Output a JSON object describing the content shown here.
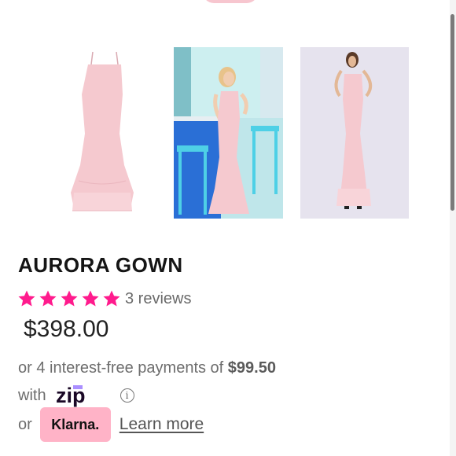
{
  "product": {
    "title": "AURORA GOWN",
    "rating_stars": 5,
    "reviews_text": "3 reviews",
    "price": "$398.00"
  },
  "payments": {
    "installments_prefix": "or 4 interest-free payments of ",
    "installment_amount": "$99.50",
    "with_label": "with",
    "zip_logo_text": "zip",
    "or_label": "or",
    "klarna_label": "Klarna.",
    "learn_more_label": "Learn more"
  },
  "colors": {
    "star": "#ff1b8d",
    "gown": "#f5c9cf",
    "klarna_badge": "#ffb3c7",
    "zip_purple": "#aa8fff"
  },
  "gallery": {
    "images": [
      {
        "name": "product-image-flat"
      },
      {
        "name": "product-image-bar-scene"
      },
      {
        "name": "product-image-studio-model"
      }
    ]
  }
}
